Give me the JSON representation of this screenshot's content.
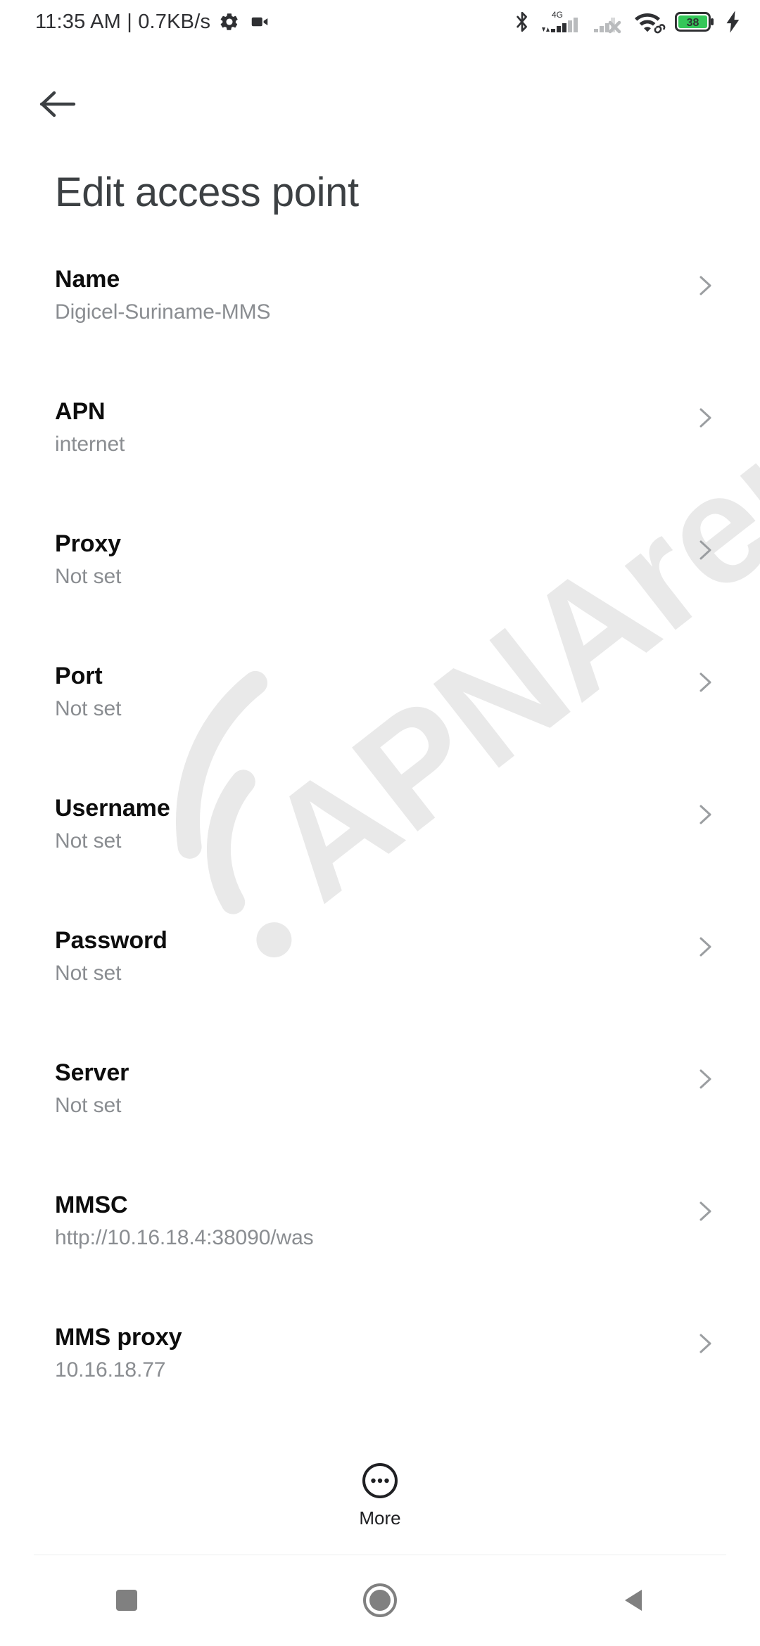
{
  "status_bar": {
    "clock": "11:35 AM | 0.7KB/s",
    "left_icons": [
      "gear-icon",
      "video-camera-icon"
    ],
    "right_icons": [
      "bluetooth-icon",
      "signal-4g-icon",
      "signal-sim2-off-icon",
      "wifi-link-icon",
      "battery-icon",
      "charging-bolt-icon"
    ],
    "network_type": "4G",
    "battery_level": "38",
    "battery_color": "#34c759"
  },
  "app_bar": {
    "back_icon": "arrow-left-icon",
    "title": "Edit access point"
  },
  "list": {
    "chevron_icon": "chevron-right-icon",
    "rows": [
      {
        "title": "Name",
        "value": "Digicel-Suriname-MMS"
      },
      {
        "title": "APN",
        "value": "internet"
      },
      {
        "title": "Proxy",
        "value": "Not set"
      },
      {
        "title": "Port",
        "value": "Not set"
      },
      {
        "title": "Username",
        "value": "Not set"
      },
      {
        "title": "Password",
        "value": "Not set"
      },
      {
        "title": "Server",
        "value": "Not set"
      },
      {
        "title": "MMSC",
        "value": "http://10.16.18.4:38090/was"
      },
      {
        "title": "MMS proxy",
        "value": "10.16.18.77"
      }
    ]
  },
  "more_button": {
    "label": "More",
    "icon": "more-circle-icon"
  },
  "watermark": {
    "text": "APNArena",
    "color": "#e9e9e9"
  },
  "nav_bar": {
    "buttons": [
      {
        "name": "recents-button",
        "icon": "square-icon"
      },
      {
        "name": "home-button",
        "icon": "circle-icon"
      },
      {
        "name": "back-button",
        "icon": "triangle-left-icon"
      }
    ],
    "icon_color": "#808080"
  }
}
